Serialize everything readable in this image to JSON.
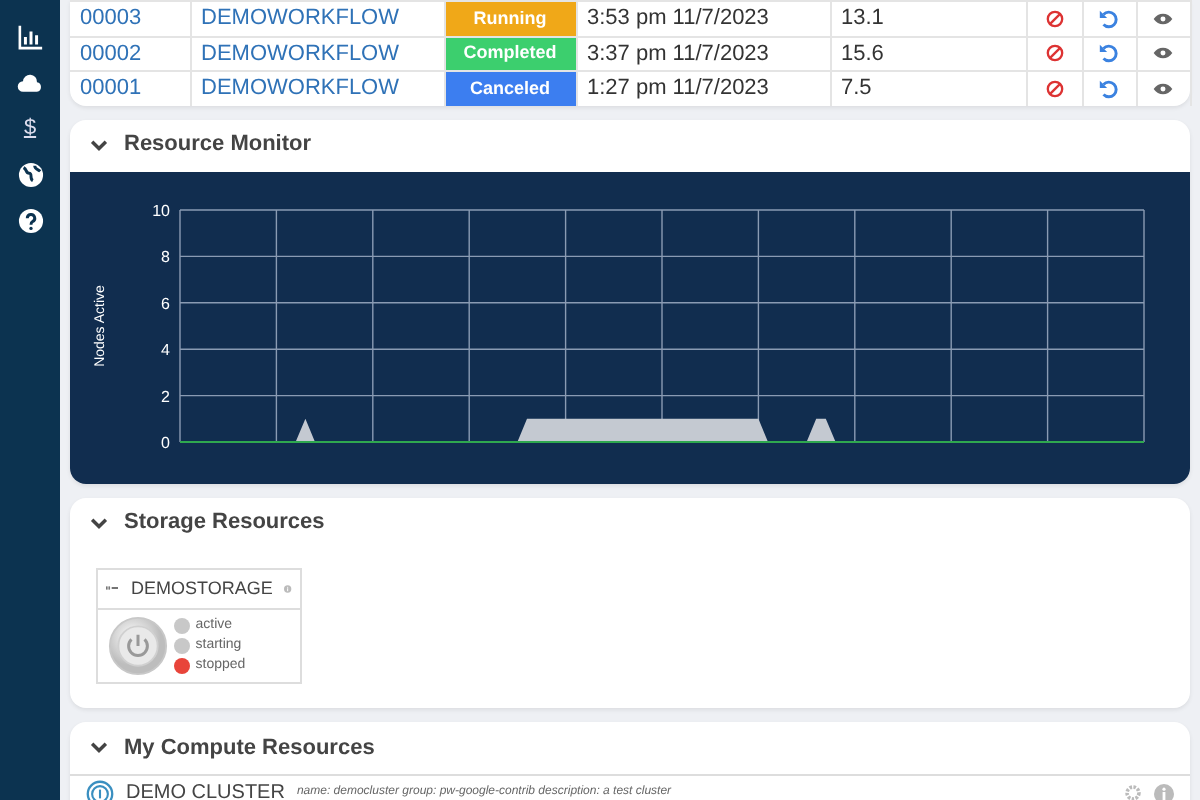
{
  "sidebar": {
    "items": [
      {
        "kind": "chart"
      },
      {
        "kind": "cloud"
      },
      {
        "kind": "text",
        "label": "$"
      },
      {
        "kind": "globe"
      },
      {
        "kind": "help"
      }
    ]
  },
  "workflows": {
    "rows": [
      {
        "id": "00003",
        "name": "DEMOWORKFLOW",
        "status": "Running",
        "color": "#f0a818",
        "time": "3:53 pm 11/7/2023",
        "value": "13.1"
      },
      {
        "id": "00002",
        "name": "DEMOWORKFLOW",
        "status": "Completed",
        "color": "#3ccf6e",
        "time": "3:37 pm 11/7/2023",
        "value": "15.6"
      },
      {
        "id": "00001",
        "name": "DEMOWORKFLOW",
        "status": "Canceled",
        "color": "#3c7ef0",
        "time": "1:27 pm 11/7/2023",
        "value": "7.5"
      }
    ]
  },
  "resource_monitor": {
    "title": "Resource Monitor",
    "chart_data": {
      "type": "area",
      "grid": true,
      "ylabel": "Nodes Active",
      "ylim": [
        0,
        10
      ],
      "yticks": [
        0,
        2,
        4,
        6,
        8,
        10
      ],
      "values": [
        0,
        0,
        0,
        0,
        0,
        0,
        0,
        0,
        0,
        0,
        0,
        0,
        0,
        1,
        0,
        0,
        0,
        0,
        0,
        0,
        0,
        0,
        0,
        0,
        0,
        0,
        0,
        0,
        0,
        0,
        0,
        0,
        0,
        0,
        0,
        0,
        1,
        1,
        1,
        1,
        1,
        1,
        1,
        1,
        1,
        1,
        1,
        1,
        1,
        1,
        1,
        1,
        1,
        1,
        1,
        1,
        1,
        1,
        1,
        1,
        1,
        0,
        0,
        0,
        0,
        0,
        1,
        1,
        0,
        0,
        0,
        0,
        0,
        0,
        0,
        0,
        0,
        0,
        0,
        0,
        0,
        0,
        0,
        0,
        0,
        0,
        0,
        0,
        0,
        0,
        0,
        0,
        0,
        0,
        0,
        0,
        0,
        0,
        0,
        0,
        0
      ]
    }
  },
  "storage": {
    "title": "Storage Resources",
    "items": [
      {
        "name": "DEMOSTORAGE",
        "states": [
          {
            "label": "active",
            "on": false
          },
          {
            "label": "starting",
            "on": false
          },
          {
            "label": "stopped",
            "on": true
          }
        ]
      }
    ]
  },
  "compute": {
    "title": "My Compute Resources",
    "items": [
      {
        "name": "DEMO CLUSTER",
        "description": "name: democluster group: pw-google-contrib description: a test cluster"
      }
    ]
  }
}
